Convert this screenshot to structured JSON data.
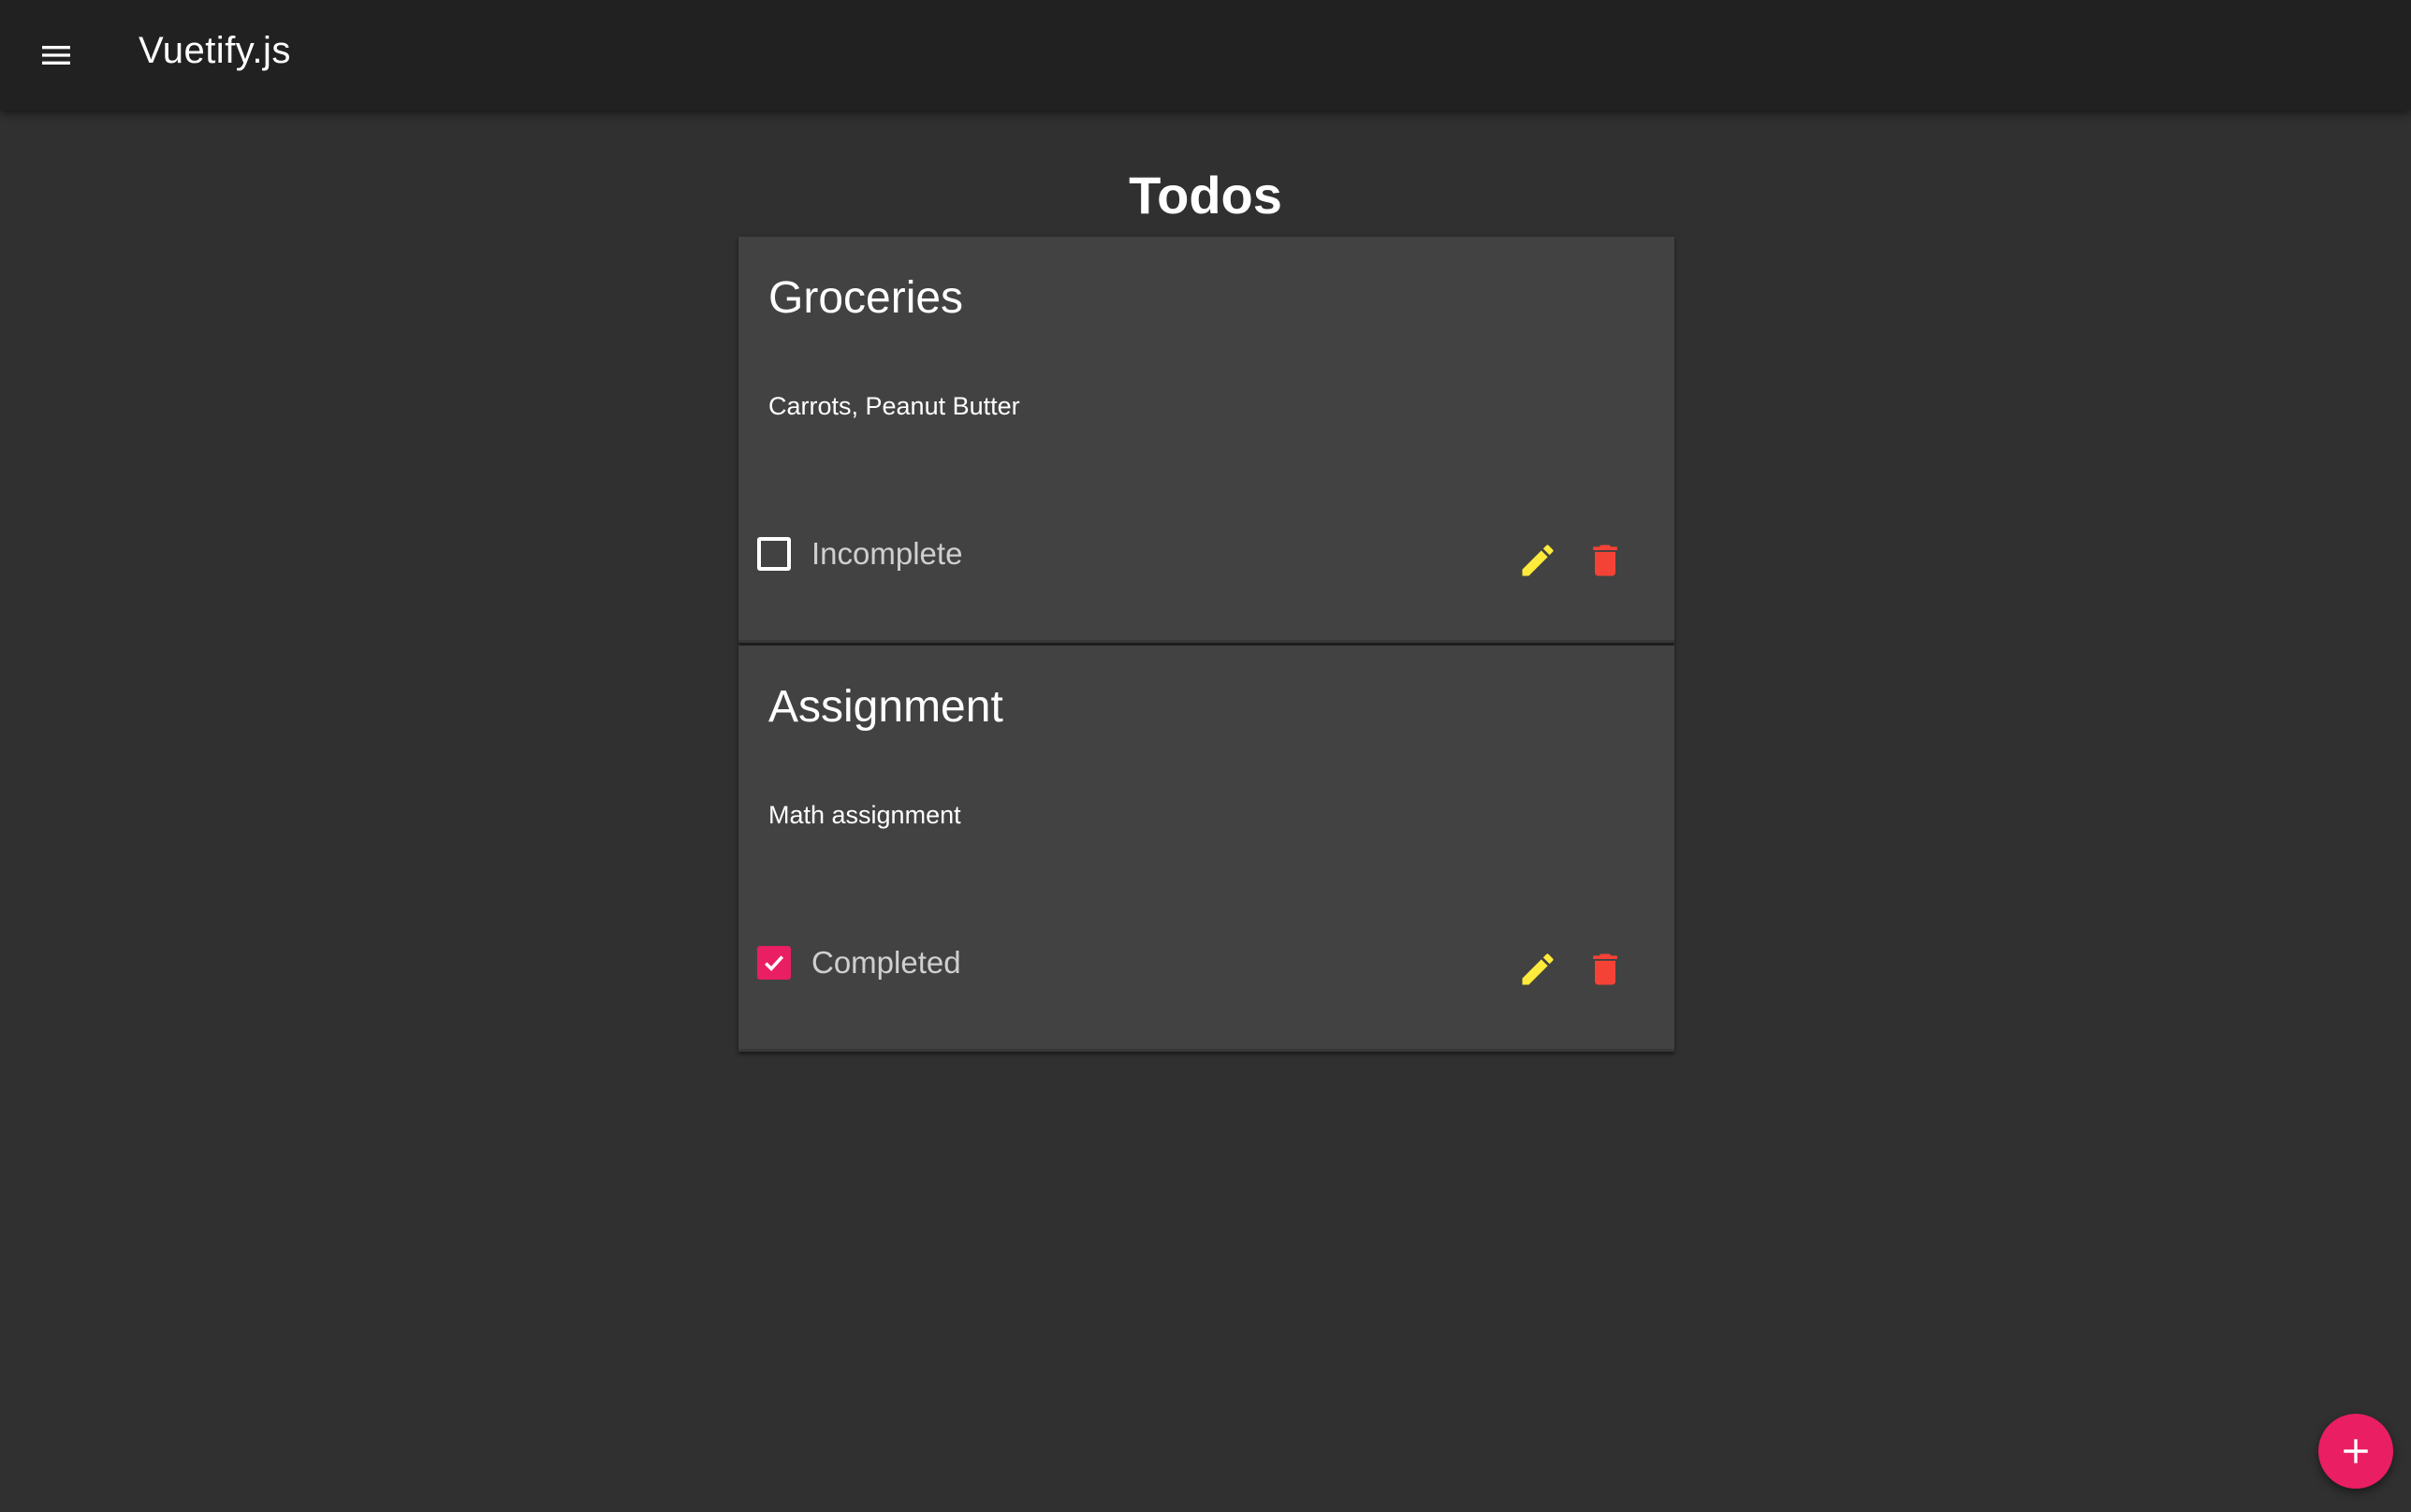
{
  "toolbar": {
    "menu_icon": "hamburger-menu-icon",
    "title": "Vuetify.js",
    "background": "#212121"
  },
  "page": {
    "title": "Todos",
    "background": "#303030"
  },
  "todos": [
    {
      "title": "Groceries",
      "description": "Carrots, Peanut Butter",
      "completed": false,
      "status_label": "Incomplete",
      "edit_icon": "pencil-icon",
      "delete_icon": "trash-icon"
    },
    {
      "title": "Assignment",
      "description": "Math assignment",
      "completed": true,
      "status_label": "Completed",
      "edit_icon": "pencil-icon",
      "delete_icon": "trash-icon"
    }
  ],
  "fab": {
    "icon": "plus-icon"
  },
  "colors": {
    "card": "#424242",
    "accent": "#e91e63",
    "edit": "#ffeb3b",
    "delete": "#f44336"
  }
}
